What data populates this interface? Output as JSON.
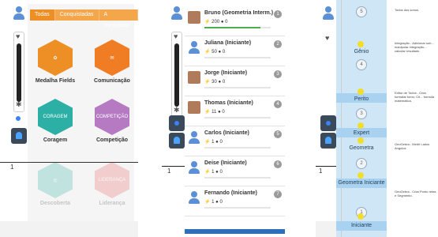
{
  "panel1": {
    "tabs": [
      "Todas",
      "Conquistadas",
      "A conquistar"
    ],
    "badges": [
      {
        "label": "Medalha Fields",
        "color": "#ee8f25",
        "text": ""
      },
      {
        "label": "Comunicação",
        "color": "#f07c24",
        "text": ""
      },
      {
        "label": "Coragem",
        "color": "#2cb0a6",
        "text": "CORAGEM"
      },
      {
        "label": "Competição",
        "color": "#b57ac2",
        "text": "COMPETIÇÃO"
      },
      {
        "label": "Descoberta",
        "color": "#9bd0c9",
        "text": ""
      },
      {
        "label": "Liderança",
        "color": "#f3a5a5",
        "text": "LIDERANÇA"
      }
    ],
    "axis_number": "1"
  },
  "panel2": {
    "ranking": [
      {
        "name": "Bruno (Geometria Interm.)",
        "points": "200",
        "coins": "0",
        "rank": "1",
        "photo": true,
        "progress": 0.85
      },
      {
        "name": "Juliana (Iniciante)",
        "points": "50",
        "coins": "0",
        "rank": "2",
        "photo": false,
        "progress": 0
      },
      {
        "name": "Jorge (Iniciante)",
        "points": "30",
        "coins": "0",
        "rank": "3",
        "photo": true,
        "progress": 0
      },
      {
        "name": "Thomas (Iniciante)",
        "points": "11",
        "coins": "0",
        "rank": "4",
        "photo": true,
        "progress": 0
      },
      {
        "name": "Carlos (Iniciante)",
        "points": "1",
        "coins": "0",
        "rank": "5",
        "photo": false,
        "progress": 0
      },
      {
        "name": "Deise (Iniciante)",
        "points": "1",
        "coins": "0",
        "rank": "6",
        "photo": false,
        "progress": 0
      },
      {
        "name": "Fernando (Iniciante)",
        "points": "1",
        "coins": "0",
        "rank": "7",
        "photo": false,
        "progress": 0
      }
    ],
    "axis_number": "1"
  },
  "panel3": {
    "levels": [
      {
        "name": "Gênio",
        "number": "4"
      },
      {
        "name": "Perito",
        "number": "3"
      },
      {
        "name": "Expert",
        "number": ""
      },
      {
        "name": "Geometra",
        "number": "2"
      },
      {
        "name": "Geometra Iniciante",
        "number": ""
      },
      {
        "name": "Iniciante",
        "number": "1"
      }
    ],
    "top_number": "5",
    "descriptions": [
      "Todos dos sonos.",
      "Integração - Adicionar sub... manipular integração... calcular resultado",
      "Editor de Todos - Criar formatar tomo; Cri... formula matemática.",
      "GeoGebra - Medir Lados Angulos",
      "GeoGebra - Criar Ponto retas e Segmento."
    ],
    "axis_number": "1"
  }
}
